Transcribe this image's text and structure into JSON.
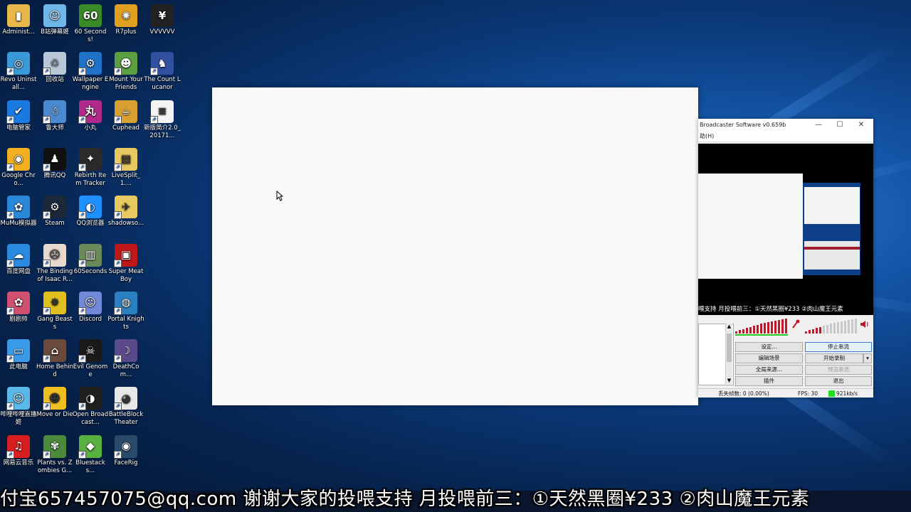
{
  "desktop": {
    "icons": [
      {
        "label": "Administ...",
        "icon": "folder-icon",
        "color": "#e8b84a",
        "glyph": "▮"
      },
      {
        "label": "B站弹幕姬",
        "icon": "anime-girl-icon",
        "color": "#6fb7e8",
        "glyph": "☺"
      },
      {
        "label": "60 Seconds!",
        "icon": "sixty-seconds-icon",
        "color": "#3a8a2a",
        "glyph": "60"
      },
      {
        "label": "R7plus",
        "icon": "r7plus-icon",
        "color": "#e0a020",
        "glyph": "✺"
      },
      {
        "label": "VVVVVV",
        "icon": "vvvvvv-icon",
        "color": "#222222",
        "glyph": "¥"
      },
      {
        "label": "Revo Uninstall...",
        "icon": "revo-uninstaller-icon",
        "color": "#3a9ad8",
        "glyph": "◎"
      },
      {
        "label": "回收站",
        "icon": "recycle-bin-icon",
        "color": "#b8c8d8",
        "glyph": "♲"
      },
      {
        "label": "Wallpaper Engine",
        "icon": "wallpaper-engine-icon",
        "color": "#1e73c8",
        "glyph": "⚙"
      },
      {
        "label": "Mount Your Friends",
        "icon": "mount-your-friends-icon",
        "color": "#5aa040",
        "glyph": "☻"
      },
      {
        "label": "The Count Lucanor",
        "icon": "count-lucanor-icon",
        "color": "#3050a0",
        "glyph": "♞"
      },
      {
        "label": "电脑管家",
        "icon": "pc-manager-icon",
        "color": "#1a7ae0",
        "glyph": "✔"
      },
      {
        "label": "鲁大师",
        "icon": "ludashi-icon",
        "color": "#4a8ad0",
        "glyph": "☃"
      },
      {
        "label": "小丸",
        "icon": "xiaowan-icon",
        "color": "#b02a8a",
        "glyph": "丸"
      },
      {
        "label": "Cuphead",
        "icon": "cuphead-icon",
        "color": "#d8a030",
        "glyph": "☕"
      },
      {
        "label": "新版简介2.0_20171...",
        "icon": "text-file-icon",
        "color": "#f4f4f4",
        "glyph": "≡"
      },
      {
        "label": "Google Chro...",
        "icon": "chrome-icon",
        "color": "#f0b020",
        "glyph": "◉"
      },
      {
        "label": "腾讯QQ",
        "icon": "qq-icon",
        "color": "#111111",
        "glyph": "♟"
      },
      {
        "label": "Rebirth Item Tracker",
        "icon": "item-tracker-icon",
        "color": "#2a2a2a",
        "glyph": "✦"
      },
      {
        "label": "LiveSplit_1....",
        "icon": "folder-zip-icon",
        "color": "#e8c860",
        "glyph": "▤"
      },
      {
        "label": "MuMu模拟器",
        "icon": "mumu-icon",
        "color": "#2a88d8",
        "glyph": "✿"
      },
      {
        "label": "Steam",
        "icon": "steam-icon",
        "color": "#1b2838",
        "glyph": "⚙"
      },
      {
        "label": "QQ浏览器",
        "icon": "qq-browser-icon",
        "color": "#1e90ff",
        "glyph": "◐"
      },
      {
        "label": "shadowso...",
        "icon": "shadowsocks-folder-icon",
        "color": "#e8c860",
        "glyph": "✈"
      },
      {
        "label": "百度网盘",
        "icon": "baidu-netdisk-icon",
        "color": "#2a8ae0",
        "glyph": "☁"
      },
      {
        "label": "The Binding of Isaac R...",
        "icon": "isaac-icon",
        "color": "#e8d8d0",
        "glyph": "☹"
      },
      {
        "label": "60Seconds",
        "icon": "sixty-seconds-can-icon",
        "color": "#6a8a5a",
        "glyph": "▥"
      },
      {
        "label": "Super Meat Boy",
        "icon": "super-meat-boy-icon",
        "color": "#c01818",
        "glyph": "▣"
      },
      {
        "label": "剧剧帅",
        "icon": "anime-avatar-icon",
        "color": "#d05070",
        "glyph": "✿"
      },
      {
        "label": "Gang Beasts",
        "icon": "gang-beasts-icon",
        "color": "#e0c020",
        "glyph": "✸"
      },
      {
        "label": "Discord",
        "icon": "discord-icon",
        "color": "#7289da",
        "glyph": "☺"
      },
      {
        "label": "Portal Knights",
        "icon": "portal-knights-icon",
        "color": "#2a80c0",
        "glyph": "◍"
      },
      {
        "label": "此电脑",
        "icon": "this-pc-icon",
        "color": "#3a9ae8",
        "glyph": "▭"
      },
      {
        "label": "Home Behind",
        "icon": "home-behind-icon",
        "color": "#6a4a3a",
        "glyph": "⌂"
      },
      {
        "label": "Evil Genome",
        "icon": "evil-genome-icon",
        "color": "#1a1a1a",
        "glyph": "☠"
      },
      {
        "label": "DeathCom...",
        "icon": "deathcoming-icon",
        "color": "#5a4a8a",
        "glyph": "☽"
      },
      {
        "label": "哔哩哔哩直播姬",
        "icon": "bilibili-live-icon",
        "color": "#5ab8e8",
        "glyph": "☺"
      },
      {
        "label": "Move or Die",
        "icon": "move-or-die-icon",
        "color": "#f0c020",
        "glyph": "☻"
      },
      {
        "label": "Open Broadcast...",
        "icon": "obs-icon",
        "color": "#202020",
        "glyph": "◑"
      },
      {
        "label": "BattleBlock Theater",
        "icon": "battleblock-icon",
        "color": "#e8e8e8",
        "glyph": "◕"
      },
      {
        "label": "网易云音乐",
        "icon": "netease-music-icon",
        "color": "#d81e1e",
        "glyph": "♫"
      },
      {
        "label": "Plants vs. Zombies G...",
        "icon": "pvz-icon",
        "color": "#4a8a3a",
        "glyph": "✾"
      },
      {
        "label": "Bluestacks...",
        "icon": "bluestacks-icon",
        "color": "#58b040",
        "glyph": "◆"
      },
      {
        "label": "FaceRig",
        "icon": "facerig-icon",
        "color": "#2a4a6a",
        "glyph": "◉"
      }
    ]
  },
  "obs": {
    "title": "Broadcaster Software v0.659b",
    "minimize": "—",
    "maximize": "☐",
    "close": "✕",
    "menu": "助(H)",
    "ticker": "喂支持  月投喂前三：①天然黑圈¥233  ②肉山魔王元素",
    "buttons": {
      "settings": "设定...",
      "stop_stream": "停止串流",
      "edit_scene": "编辑场景",
      "start_record": "开始录制",
      "global_sources": "全局来源...",
      "preview_stream": "预览串流",
      "plugins": "插件",
      "exit": "退出"
    },
    "status": {
      "dropped_frames": "丢失帧数: 0 (0.00%)",
      "fps": "FPS: 30",
      "bitrate": "921kb/s"
    },
    "colors": {
      "meter_active": "#c0182a",
      "meter_idle": "#c8c8c8",
      "mic": "#c0182a",
      "bitrate": "#22dd22"
    }
  },
  "subtitle": {
    "text": "付宝657457075@qq.com  谢谢大家的投喂支持  月投喂前三：①天然黑圈¥233  ②肉山魔王元素"
  }
}
